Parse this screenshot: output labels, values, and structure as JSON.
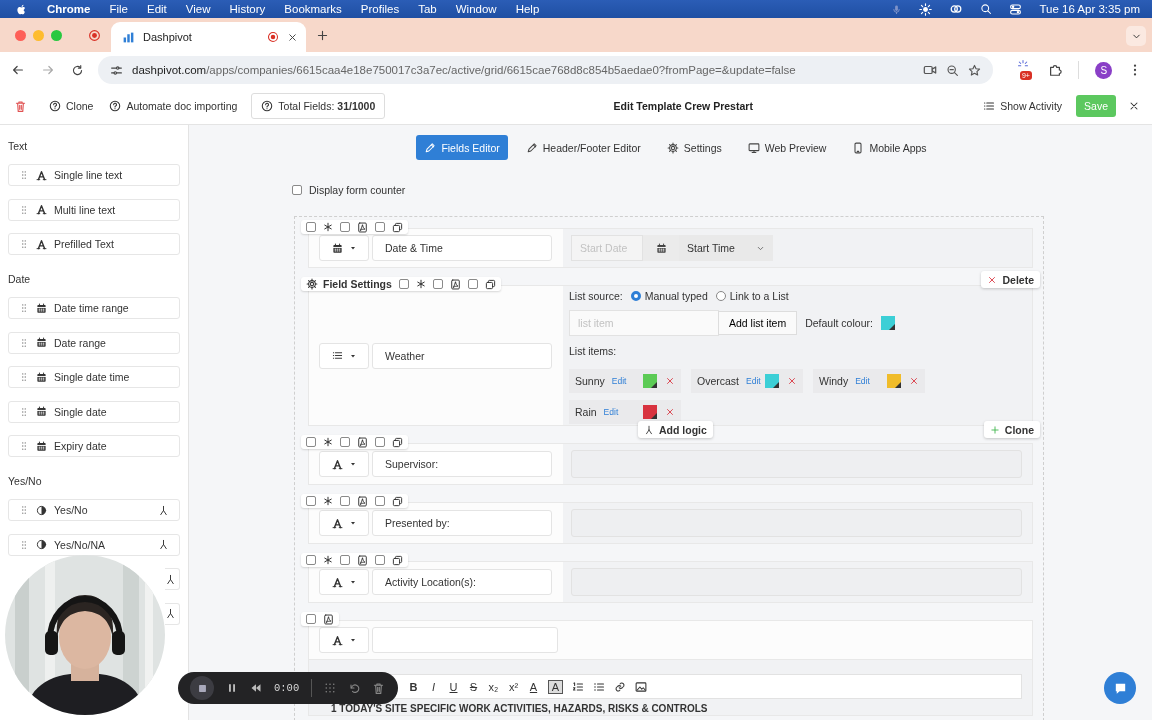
{
  "menubar": {
    "app": "Chrome",
    "items": [
      "File",
      "Edit",
      "View",
      "History",
      "Bookmarks",
      "Profiles",
      "Tab",
      "Window",
      "Help"
    ],
    "clock": "Tue 16 Apr 3:35 pm"
  },
  "browser": {
    "tab_title": "Dashpivot",
    "url_domain": "dashpivot.com",
    "url_path": "/apps/companies/6615caa4e18e750017c3a7ec/active/grid/6615cae768d8c854b5aedae0?fromPage=&update=false",
    "extension_badge": "9+",
    "profile_initial": "S"
  },
  "toolbar": {
    "clone": "Clone",
    "automate": "Automate doc importing",
    "total_fields": "Total Fields: **31/1000**",
    "title": "Edit Template Crew Prestart",
    "show_activity": "Show Activity",
    "save": "Save"
  },
  "sidebar": {
    "sections": [
      {
        "heading": "Text",
        "kind": "text",
        "items": [
          {
            "label": "Single line text",
            "logic": false
          },
          {
            "label": "Multi line text",
            "logic": false
          },
          {
            "label": "Prefilled Text",
            "logic": false
          }
        ]
      },
      {
        "heading": "Date",
        "kind": "date",
        "items": [
          {
            "label": "Date time range",
            "logic": false
          },
          {
            "label": "Date range",
            "logic": false
          },
          {
            "label": "Single date time",
            "logic": false
          },
          {
            "label": "Single date",
            "logic": false
          },
          {
            "label": "Expiry date",
            "logic": false
          }
        ]
      },
      {
        "heading": "Yes/No",
        "kind": "yesno",
        "items": [
          {
            "label": "Yes/No",
            "logic": true
          },
          {
            "label": "Yes/No/NA",
            "logic": true
          },
          {
            "logic": true
          },
          {
            "logic": true
          }
        ]
      }
    ]
  },
  "editor_tabs": [
    {
      "label": "Fields Editor",
      "selected": true
    },
    {
      "label": "Header/Footer Editor",
      "selected": false
    },
    {
      "label": "Settings",
      "selected": false
    },
    {
      "label": "Web Preview",
      "selected": false
    },
    {
      "label": "Mobile Apps",
      "selected": false
    }
  ],
  "form_counter": {
    "label": "Display form counter",
    "checked": false
  },
  "fields": [
    {
      "kind": "datetime",
      "label": "Date & Time",
      "checks": [
        false,
        false,
        false
      ],
      "date_placeholder": "Start Date",
      "time_value": "Start Time"
    },
    {
      "kind": "list",
      "label": "Weather",
      "settings": "Field Settings",
      "checks": [
        false,
        false,
        false
      ],
      "source_label": "List source:",
      "sources": [
        {
          "label": "Manual typed",
          "selected": true
        },
        {
          "label": "Link to a List",
          "selected": false
        }
      ],
      "item_placeholder": "list item",
      "add_item": "Add list item",
      "default_colour_label": "Default colour:",
      "default_colour_swatch": {
        "color": "#3ccfd6"
      },
      "items_label": "List items:",
      "items": [
        {
          "label": "Sunny",
          "edit": "Edit",
          "color": "#5ccb55"
        },
        {
          "label": "Overcast",
          "edit": "Edit",
          "color": "#3ccfd6"
        },
        {
          "label": "Windy",
          "edit": "Edit",
          "color": "#f0bc2a"
        },
        {
          "label": "Rain",
          "edit": "Edit",
          "color": "#d8333f"
        }
      ],
      "delete": "Delete",
      "clone": "Clone",
      "add_logic": "Add logic"
    },
    {
      "kind": "text",
      "label": "Supervisor:",
      "checks": [
        false,
        false,
        false
      ]
    },
    {
      "kind": "text",
      "label": "Presented by:",
      "checks": [
        false,
        false,
        false
      ]
    },
    {
      "kind": "text",
      "label": "Activity Location(s):",
      "checks": [
        false,
        false,
        false
      ]
    },
    {
      "kind": "richtext",
      "checks": [
        false
      ],
      "tools": [
        "B",
        "I",
        "U",
        "S",
        "x₂",
        "x²",
        "A",
        "A"
      ],
      "content": "1 TODAY'S SITE SPECIFIC WORK ACTIVITIES, HAZARDS, RISKS & CONTROLS"
    }
  ],
  "recorder": {
    "time": "0:00"
  }
}
